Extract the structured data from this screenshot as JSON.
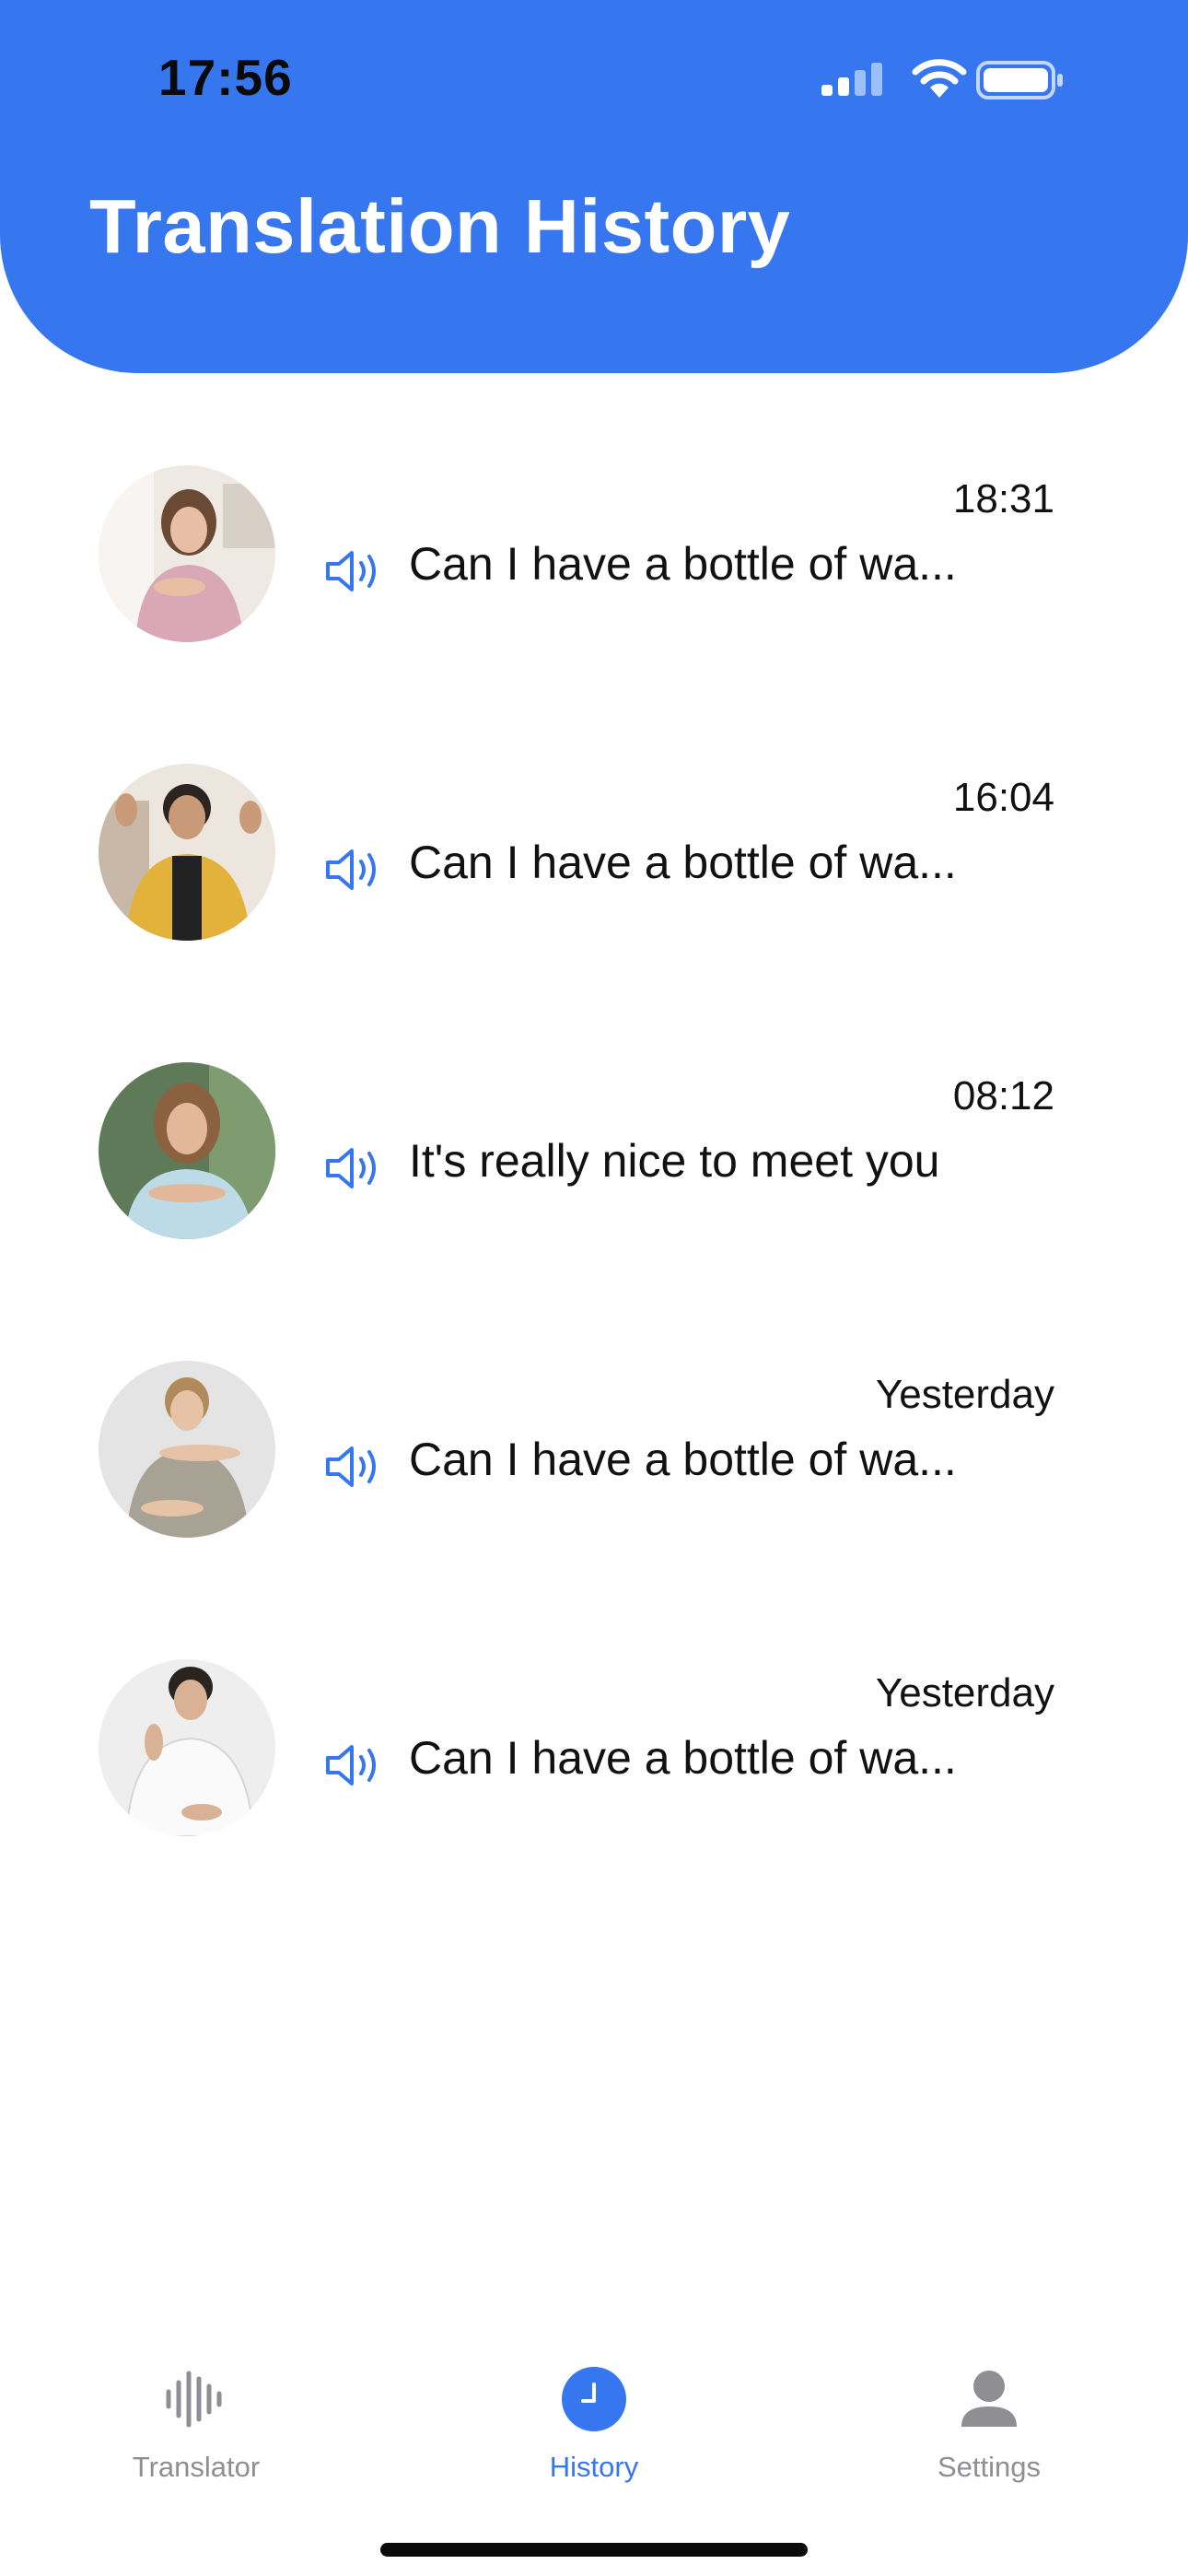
{
  "status_bar": {
    "time": "17:56"
  },
  "header": {
    "title": "Translation History"
  },
  "history": [
    {
      "time": "18:31",
      "text": "Can I have a bottle of wa..."
    },
    {
      "time": "16:04",
      "text": "Can I have a bottle of wa..."
    },
    {
      "time": "08:12",
      "text": "It's really nice to meet you"
    },
    {
      "time": "Yesterday",
      "text": "Can I have a bottle of wa..."
    },
    {
      "time": "Yesterday",
      "text": "Can I have a bottle of wa..."
    }
  ],
  "tabs": [
    {
      "label": "Translator",
      "icon": "waveform-icon",
      "active": false
    },
    {
      "label": "History",
      "icon": "clock-icon",
      "active": true
    },
    {
      "label": "Settings",
      "icon": "person-icon",
      "active": false
    }
  ],
  "colors": {
    "accent": "#3677F0",
    "inactive": "#8e8e93"
  }
}
